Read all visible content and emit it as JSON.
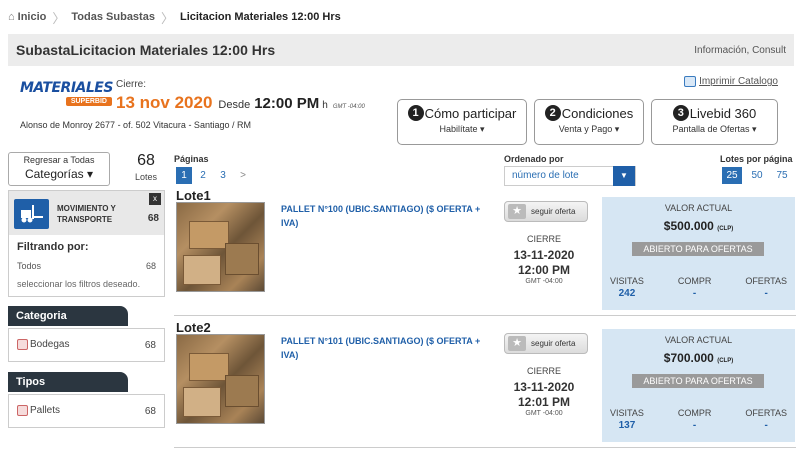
{
  "breadcrumb": {
    "home": "Inicio",
    "all": "Todas Subastas",
    "current": "Licitacion Materiales 12:00 Hrs"
  },
  "titlebar": {
    "title": "SubastaLicitacion Materiales 12:00 Hrs",
    "info": "Información, Consult"
  },
  "header": {
    "logo_word": "MATERIALES",
    "logo_tag": "SUPERBID",
    "cierre_label": "Cierre:",
    "date": "13 nov 2020",
    "desde": "Desde",
    "time": "12:00 PM",
    "h": "h",
    "gmt": "GMT -04:00",
    "address": "Alonso de Monroy 2677 - of. 502 Vitacura - Santiago / RM",
    "print": "Imprimir Catalogo",
    "buttons": [
      {
        "num": "1",
        "label": "Cómo participar",
        "sub": "Habilítate ▾"
      },
      {
        "num": "2",
        "label": "Condiciones",
        "sub": "Venta y Pago ▾"
      },
      {
        "num": "3",
        "label": "Livebid 360",
        "sub": "Pantalla de Ofertas ▾"
      }
    ]
  },
  "sidebar": {
    "regresar_line1": "Regresar a Todas",
    "regresar_line2": "Categorías ▾",
    "lot_count": "68",
    "lot_count_label": "Lotes",
    "category_name": "MOVIMIENTO Y TRANSPORTE",
    "category_count": "68",
    "category_close": "x",
    "filtering_label": "Filtrando por:",
    "filter_value": "Todos",
    "filter_count": "68",
    "filter_hint": "seleccionar los filtros deseado.",
    "facets": [
      {
        "title": "Categoria",
        "option": "Bodegas",
        "count": "68"
      },
      {
        "title": "Tipos",
        "option": "Pallets",
        "count": "68"
      }
    ]
  },
  "controls": {
    "pages_label": "Páginas",
    "pages": [
      "1",
      "2",
      "3",
      ">"
    ],
    "sort_label": "Ordenado por",
    "sort_value": "número de lote",
    "per_page_label": "Lotes por página",
    "per_page": [
      "25",
      "50",
      "75"
    ]
  },
  "lots": [
    {
      "title": "Lote1",
      "desc": "PALLET N°100 (UBIC.SANTIAGO) ($ OFERTA + IVA)",
      "follow": "seguir oferta",
      "cierre": "CIERRE",
      "date": "13-11-2020",
      "time": "12:00 PM",
      "gmt": "GMT -04:00",
      "value_label": "VALOR ACTUAL",
      "value": "$500.000",
      "currency": "(CLP)",
      "status": "ABIERTO PARA OFERTAS",
      "visitas_label": "VISITAS",
      "visitas": "242",
      "compr_label": "COMPR",
      "compr": "-",
      "ofertas_label": "OFERTAS",
      "ofertas": "-"
    },
    {
      "title": "Lote2",
      "desc": "PALLET N°101 (UBIC.SANTIAGO) ($ OFERTA + IVA)",
      "follow": "seguir oferta",
      "cierre": "CIERRE",
      "date": "13-11-2020",
      "time": "12:01 PM",
      "gmt": "GMT -04:00",
      "value_label": "VALOR ACTUAL",
      "value": "$700.000",
      "currency": "(CLP)",
      "status": "ABIERTO PARA OFERTAS",
      "visitas_label": "VISITAS",
      "visitas": "137",
      "compr_label": "COMPR",
      "compr": "-",
      "ofertas_label": "OFERTAS",
      "ofertas": "-"
    }
  ],
  "colors": {
    "accent_orange": "#e8731e",
    "brand_blue": "#1f5fa8",
    "panel_blue": "#d6e6f3"
  }
}
